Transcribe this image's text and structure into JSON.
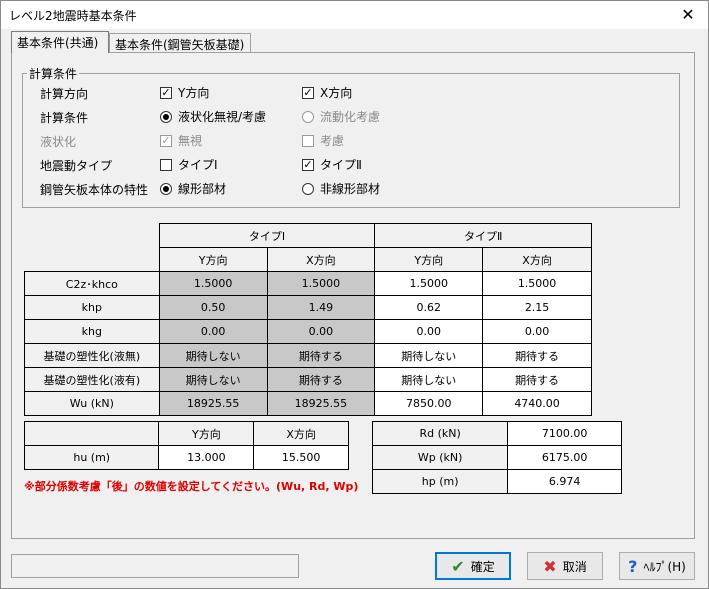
{
  "window": {
    "title": "レベル2地震時基本条件",
    "close": "✕"
  },
  "tabs": [
    "基本条件(共通)",
    "基本条件(鋼管矢板基礎)"
  ],
  "group": {
    "legend": "計算条件",
    "rows": [
      {
        "label": "計算方向",
        "a": {
          "text": "Y方向",
          "type": "check",
          "checked": true
        },
        "b": {
          "text": "X方向",
          "type": "check",
          "checked": true
        }
      },
      {
        "label": "計算条件",
        "a": {
          "text": "液状化無視/考慮",
          "type": "radio",
          "checked": true
        },
        "b": {
          "text": "流動化考慮",
          "type": "radio",
          "checked": false,
          "disabled": true
        }
      },
      {
        "label": "液状化",
        "disabled": true,
        "a": {
          "text": "無視",
          "type": "check",
          "checked": true,
          "disabled": true
        },
        "b": {
          "text": "考慮",
          "type": "check",
          "checked": false,
          "disabled": true
        }
      },
      {
        "label": "地震動タイプ",
        "a": {
          "text": "タイプⅠ",
          "type": "check",
          "checked": false
        },
        "b": {
          "text": "タイプⅡ",
          "type": "check",
          "checked": true
        }
      },
      {
        "label": "鋼管矢板本体の特性",
        "a": {
          "text": "線形部材",
          "type": "radio",
          "checked": true
        },
        "b": {
          "text": "非線形部材",
          "type": "radio",
          "checked": false
        }
      }
    ]
  },
  "main_table": {
    "type_headers": [
      "タイプⅠ",
      "タイプⅡ"
    ],
    "dir_headers": [
      "Y方向",
      "X方向",
      "Y方向",
      "X方向"
    ],
    "rows": [
      {
        "label": "C2z･khco",
        "values": [
          "1.5000",
          "1.5000",
          "1.5000",
          "1.5000"
        ]
      },
      {
        "label": "khp",
        "values": [
          "0.50",
          "1.49",
          "0.62",
          "2.15"
        ]
      },
      {
        "label": "khg",
        "values": [
          "0.00",
          "0.00",
          "0.00",
          "0.00"
        ]
      },
      {
        "label": "基礎の塑性化(液無)",
        "values": [
          "期待しない",
          "期待する",
          "期待しない",
          "期待する"
        ]
      },
      {
        "label": "基礎の塑性化(液有)",
        "values": [
          "期待しない",
          "期待する",
          "期待しない",
          "期待する"
        ]
      },
      {
        "label": "Wu (kN)",
        "values": [
          "18925.55",
          "18925.55",
          "7850.00",
          "4740.00"
        ]
      }
    ]
  },
  "hu_table": {
    "headers": [
      "Y方向",
      "X方向"
    ],
    "label": "hu (m)",
    "values": [
      "13.000",
      "15.500"
    ]
  },
  "right_table": [
    {
      "label": "Rd (kN)",
      "value": "7100.00"
    },
    {
      "label": "Wp (kN)",
      "value": "6175.00"
    },
    {
      "label": "hp (m)",
      "value": "6.974"
    }
  ],
  "note": "※部分係数考慮「後」の数値を設定してください。(Wu, Rd, Wp)",
  "buttons": {
    "ok": "確定",
    "cancel": "取消",
    "help": "ﾍﾙﾌﾟ(H)"
  },
  "colors": {
    "gray_cell": "#c8c8c8",
    "note_red": "#e00000",
    "ok_green": "#2e8b2e",
    "cancel_red": "#d03030",
    "help_blue": "#1e5bd0"
  },
  "icons": {
    "ok": "check-icon",
    "cancel": "x-icon",
    "help": "question-icon"
  }
}
